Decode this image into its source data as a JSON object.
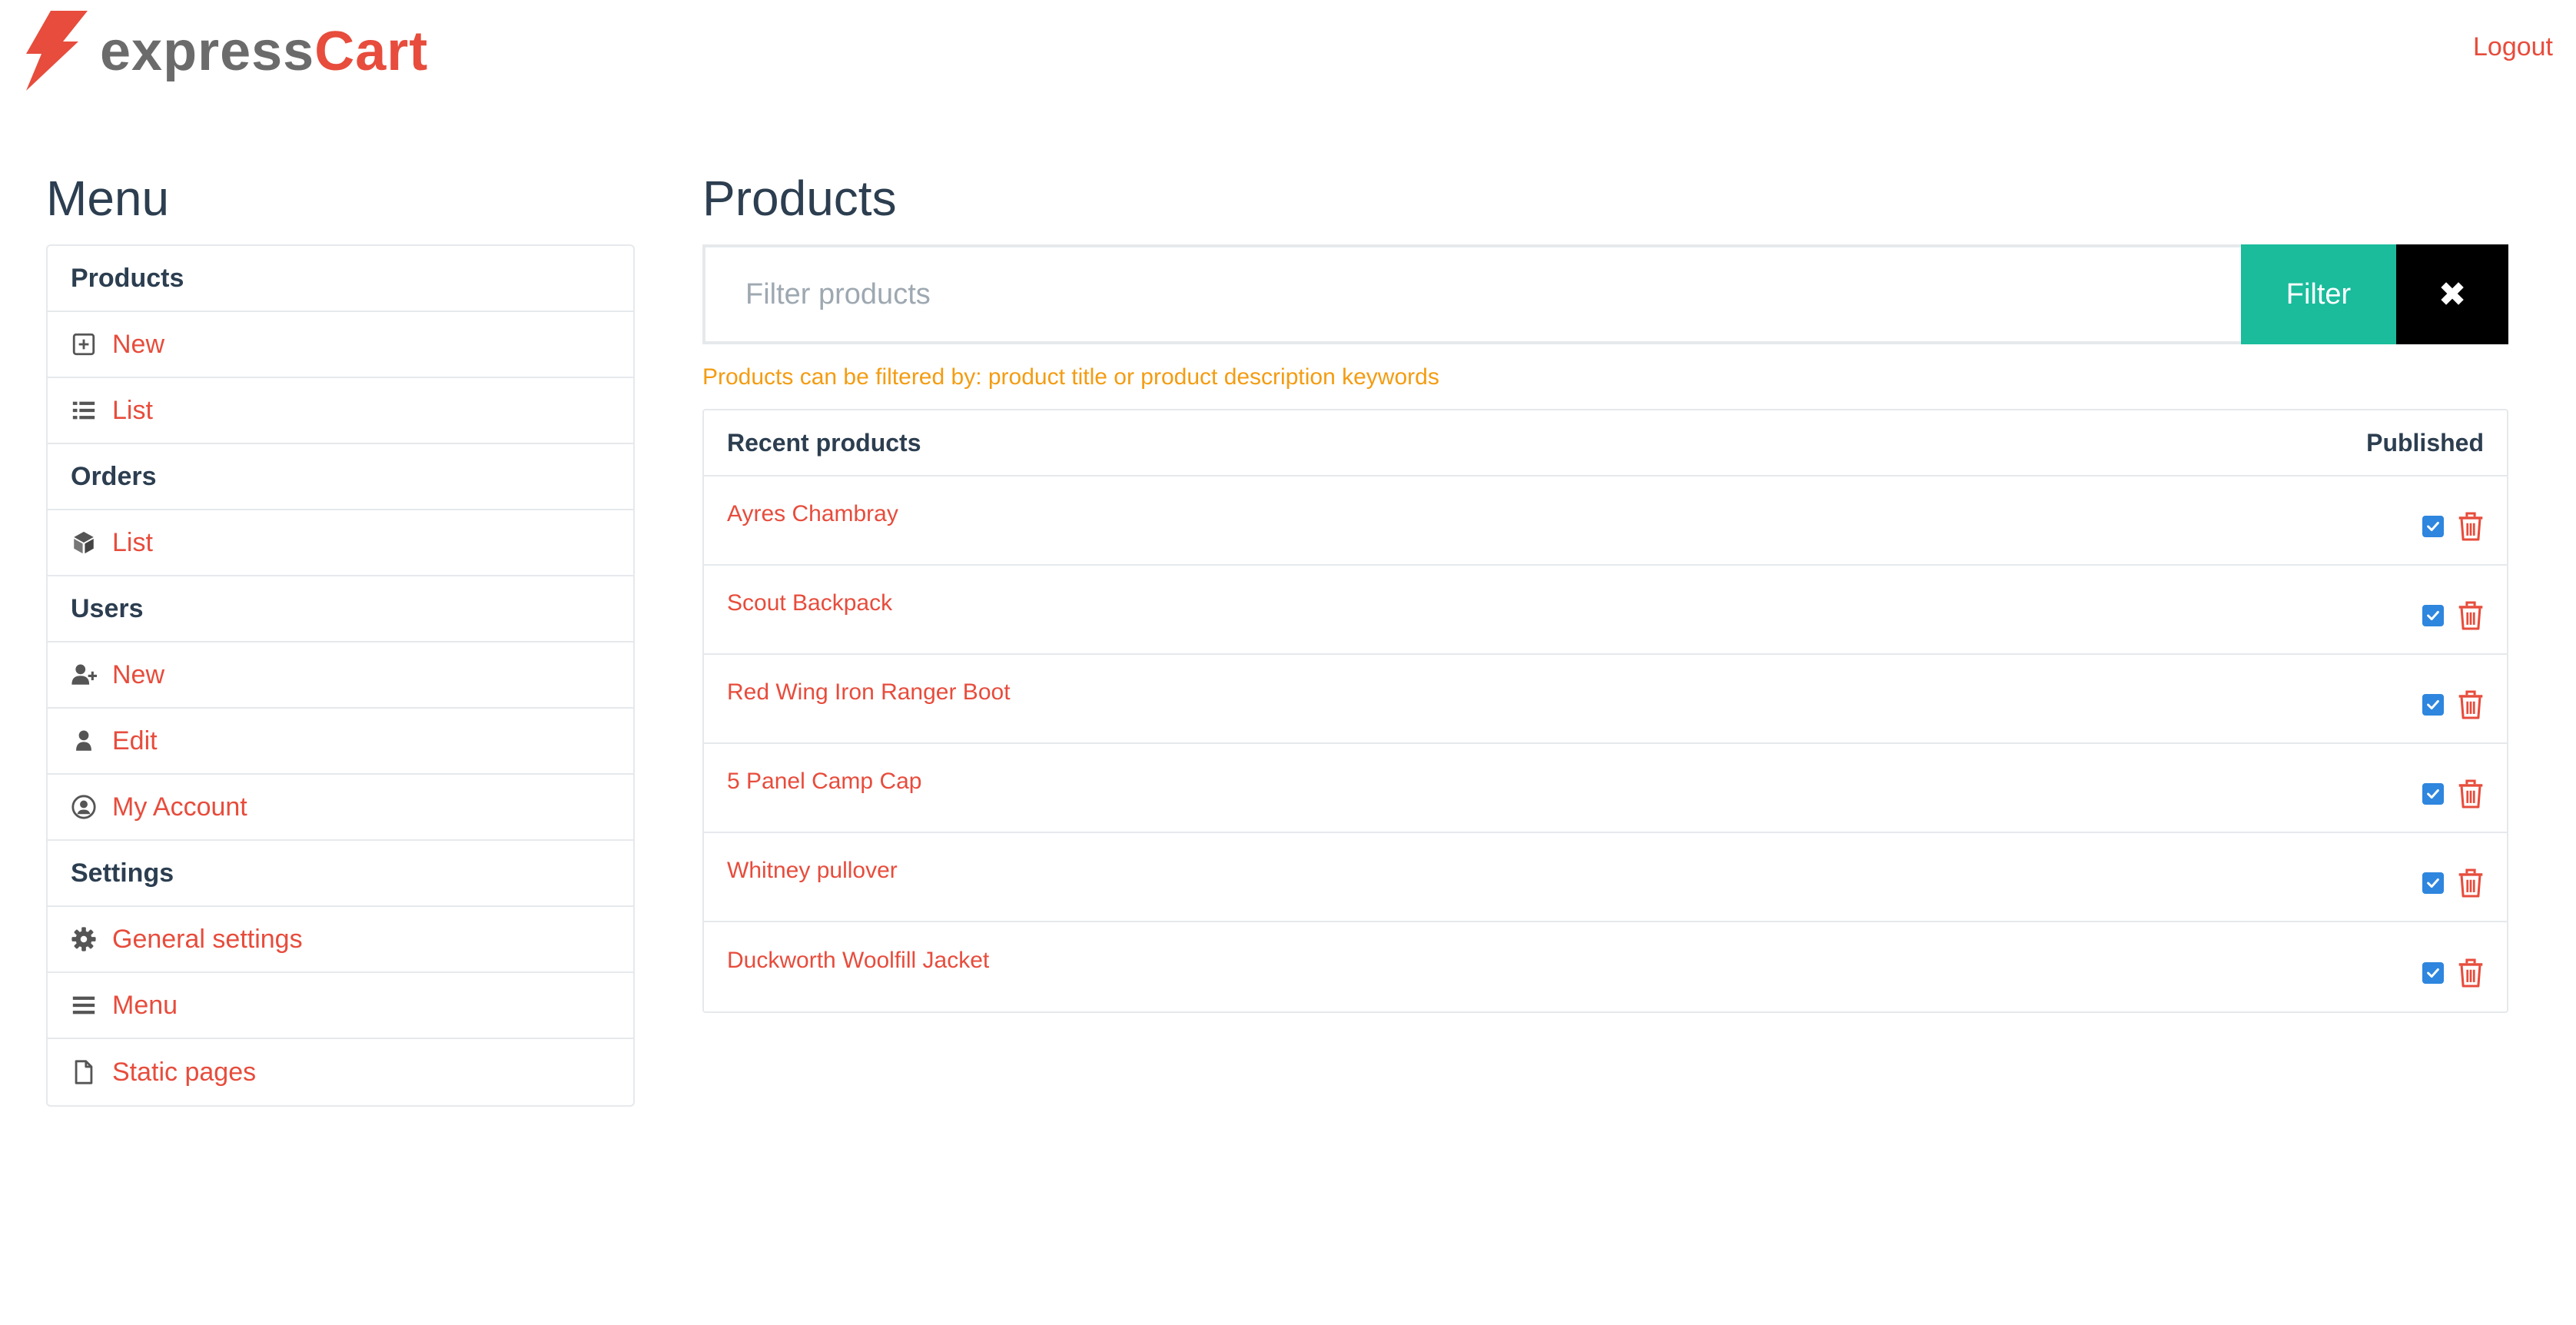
{
  "header": {
    "brand_part1": "express",
    "brand_part2": "Cart",
    "logout_label": "Logout"
  },
  "sidebar": {
    "title": "Menu",
    "products_header": "Products",
    "products_new": "New",
    "products_list": "List",
    "orders_header": "Orders",
    "orders_list": "List",
    "users_header": "Users",
    "users_new": "New",
    "users_edit": "Edit",
    "users_account": "My Account",
    "settings_header": "Settings",
    "settings_general": "General settings",
    "settings_menu": "Menu",
    "settings_static": "Static pages"
  },
  "main": {
    "title": "Products",
    "filter_placeholder": "Filter products",
    "filter_button": "Filter",
    "clear_button": "✖",
    "hint": "Products can be filtered by: product title or product description keywords",
    "table": {
      "header_left": "Recent products",
      "header_right": "Published",
      "rows": [
        {
          "name": "Ayres Chambray",
          "published": true
        },
        {
          "name": "Scout Backpack",
          "published": true
        },
        {
          "name": "Red Wing Iron Ranger Boot",
          "published": true
        },
        {
          "name": "5 Panel Camp Cap",
          "published": true
        },
        {
          "name": "Whitney pullover",
          "published": true
        },
        {
          "name": "Duckworth Woolfill Jacket",
          "published": true
        }
      ]
    }
  },
  "colors": {
    "accent": "#e74c3c",
    "filter_button": "#1abc9c",
    "hint": "#f39c12",
    "checkbox": "#2e86de",
    "text": "#2c3e50"
  },
  "icons": {
    "logo": "lightning-bolt-icon",
    "products_new": "plus-square-icon",
    "products_list": "list-icon",
    "orders_list": "cube-icon",
    "users_new": "user-plus-icon",
    "users_edit": "user-icon",
    "users_account": "user-circle-icon",
    "settings_general": "gear-icon",
    "settings_menu": "bars-icon",
    "settings_static": "file-icon",
    "row_delete": "trash-icon"
  }
}
